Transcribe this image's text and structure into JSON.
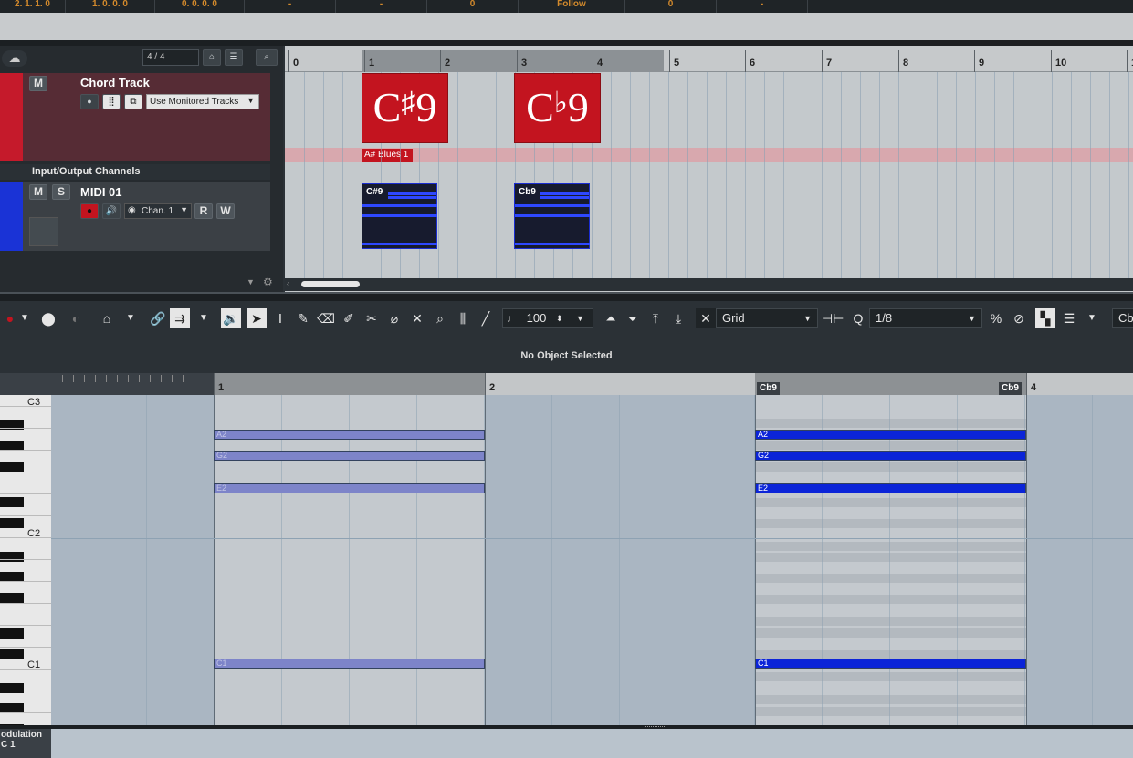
{
  "transport": {
    "pos_left": "2. 1. 1.   0",
    "pos_a": "1. 0. 0.   0",
    "pos_b": "0. 0. 0.   0",
    "dash1": "-",
    "dash2": "-",
    "zero1": "0",
    "follow": "Follow",
    "zero2": "0",
    "dash3": "-"
  },
  "tracklist": {
    "signature": "4 / 4",
    "chord_track": {
      "mute": "M",
      "name": "Chord Track",
      "monitor_option": "Use Monitored Tracks"
    },
    "folder_name": "Input/Output Channels",
    "midi_track": {
      "mute": "M",
      "solo": "S",
      "name": "MIDI 01",
      "channel": "Chan. 1",
      "read": "R",
      "write": "W"
    }
  },
  "arrange": {
    "bars": [
      "0",
      "1",
      "2",
      "3",
      "4",
      "5",
      "6",
      "7",
      "8",
      "9",
      "10",
      "1"
    ],
    "chord_events": [
      {
        "root": "C",
        "accidental": "♯",
        "ext": "9"
      },
      {
        "root": "C",
        "accidental": "♭",
        "ext": "9"
      }
    ],
    "scale_label": "A# Blues 1",
    "midi_parts": [
      {
        "label": "C#9"
      },
      {
        "label": "Cb9"
      }
    ]
  },
  "toolbar": {
    "velocity": "100",
    "snap_mode": "Grid",
    "quantize": "1/8",
    "chord_box": "Cb"
  },
  "info_line": "No Object Selected",
  "key_editor": {
    "bars": [
      "1",
      "2",
      "4"
    ],
    "chord_tags": [
      "Cb9",
      "Cb9"
    ],
    "key_labels": [
      "C3",
      "C2",
      "C1"
    ],
    "ghost_notes": [
      "A2",
      "G2",
      "E2",
      "C1"
    ],
    "solid_notes": [
      "A2",
      "G2",
      "E2",
      "C1"
    ]
  },
  "controller_lane": {
    "label_line1": "odulation",
    "label_line2": "C 1"
  }
}
